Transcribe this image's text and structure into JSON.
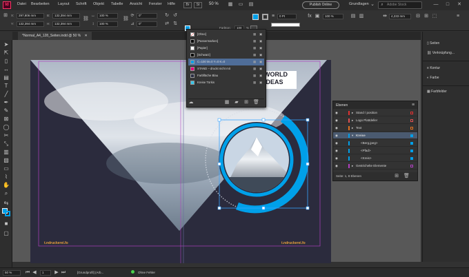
{
  "menubar": {
    "logo": "Id",
    "items": [
      "Datei",
      "Bearbeiten",
      "Layout",
      "Schrift",
      "Objekt",
      "Tabelle",
      "Ansicht",
      "Fenster",
      "Hilfe"
    ],
    "zoom": "50 %",
    "publish_label": "Publish Online",
    "workspace": "Grundlagen",
    "search_placeholder": "Adobe Stock"
  },
  "control": {
    "x_label": "X:",
    "x_value": "297,806 mm",
    "y_label": "Y:",
    "y_value": "132,394 mm",
    "b_label": "B:",
    "b_value": "132,394 mm",
    "h_label": "H:",
    "h_value": "132,394 mm",
    "scale_x": "100 %",
    "scale_y": "100 %",
    "angle": "0°",
    "shear": "0°",
    "stroke_weight": "0 Pt",
    "opacity": "100 %",
    "tint_label": "Farbton:",
    "tint_value": "100",
    "pct": "%",
    "ref_value": "4,233 mm",
    "fx_value": "0 Pt"
  },
  "tab": {
    "label": "*Normal_A4_128_Seiten.indd @ 50 %"
  },
  "swatches": {
    "rows": [
      {
        "name": "[Ohne]",
        "color": "#ffffff",
        "none": true
      },
      {
        "name": "[Passermarken]",
        "color": "#000000"
      },
      {
        "name": "[Papier]",
        "color": "#ffffff"
      },
      {
        "name": "[Schwarz]",
        "color": "#000000"
      },
      {
        "name": "C=100 M=0 Y=0 K=0",
        "color": "#00a0e9",
        "selected": true
      },
      {
        "name": "STAND – druckt nicht mit",
        "color": "#e6007e"
      },
      {
        "name": "Farbfläche Blau",
        "color": "#2b2f44"
      },
      {
        "name": "Kreise Türkis",
        "color": "#36c3e6"
      }
    ]
  },
  "page": {
    "logo_left": "t.ndruckerei.fo",
    "logo_right": "t.ndruckerei.fo",
    "title_line1": "WORLD",
    "title_line2": "IDEAS"
  },
  "layers": {
    "title": "Ebenen",
    "rows": [
      {
        "name": "Stand / position",
        "color": "#e03030",
        "indent": 0
      },
      {
        "name": "Logo Plattdeller",
        "color": "#e05050",
        "indent": 0
      },
      {
        "name": "Text",
        "color": "#e07020",
        "indent": 0
      },
      {
        "name": "Kreise",
        "color": "#00a0e9",
        "indent": 0,
        "selected": true
      },
      {
        "name": "<Berg.jpeg>",
        "color": "#00a0e9",
        "indent": 1
      },
      {
        "name": "<Pfad>",
        "color": "#00a0e9",
        "indent": 1
      },
      {
        "name": "<Kreis>",
        "color": "#00a0e9",
        "indent": 1
      },
      {
        "name": "Gestrichelte Elemente",
        "color": "#b040c0",
        "indent": 0
      }
    ],
    "footer": "Seite: 1, 8 Ebenen"
  },
  "rightpanel": {
    "items": [
      "Seiten",
      "Verknüpfung...",
      "Kontur",
      "Farbe",
      "Farbfelder"
    ]
  },
  "status": {
    "zoom": "50 %",
    "page": "1",
    "profile": "[Grundprofil] (Arb...",
    "preflight": "Ohne Fehler"
  },
  "colors": {
    "accent": "#00a0e9",
    "navy": "#2b2b3d",
    "guide": "#b040c0"
  }
}
